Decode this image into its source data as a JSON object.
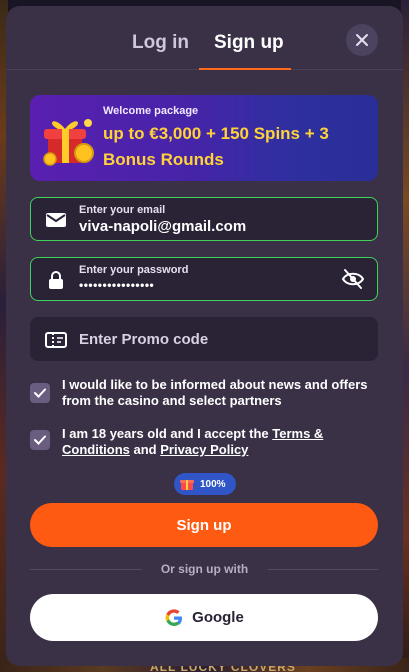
{
  "tabs": {
    "login": "Log in",
    "signup": "Sign up"
  },
  "banner": {
    "kicker": "Welcome package",
    "title": "up to €3,000 + 150 Spins + 3 Bonus Rounds"
  },
  "email": {
    "label": "Enter your email",
    "value": "viva-napoli@gmail.com"
  },
  "password": {
    "label": "Enter your password",
    "value": "••••••••••••••••"
  },
  "promo": {
    "placeholder": "Enter Promo code"
  },
  "consent_news": {
    "checked": true,
    "text": "I would like to be informed about news and offers from the casino and select partners"
  },
  "consent_age": {
    "checked": true,
    "text_prefix": "I am 18 years old and I accept the ",
    "terms_link": "Terms & Conditions",
    "text_and": " and ",
    "privacy_link": "Privacy Policy"
  },
  "progress": {
    "label": "100%",
    "percent": 100
  },
  "signup_button": "Sign up",
  "divider": "Or sign up with",
  "google_button": "Google",
  "background_text": "ALL LUCKY CLOVERS",
  "colors": {
    "accent": "#ff5a12",
    "success_border": "#3ed35a",
    "banner_title": "#ffd23a",
    "modal_bg": "#3a3147"
  }
}
